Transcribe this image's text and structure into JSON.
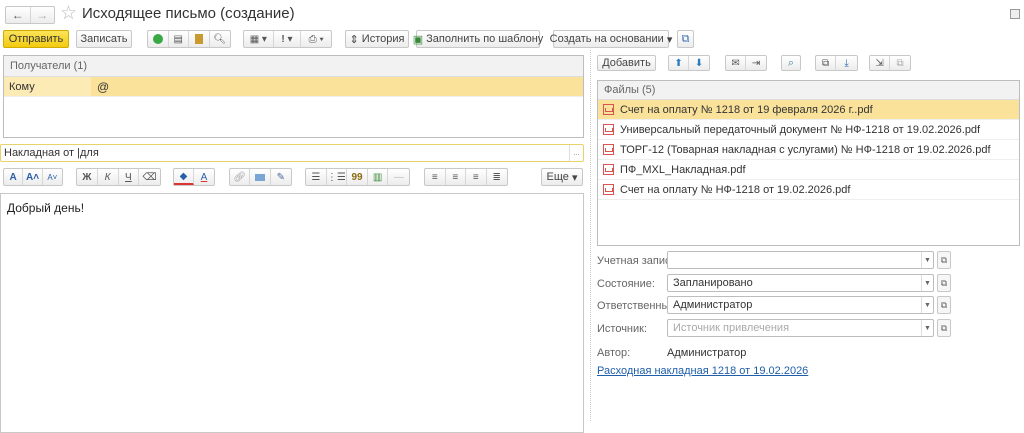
{
  "window": {
    "title": "Исходящее письмо (создание)",
    "back": "←",
    "forward": "→",
    "star": "☆"
  },
  "toolbar": {
    "send": "Отправить",
    "save": "Записать",
    "history": "История",
    "fill_template": "Заполнить по шаблону",
    "create_based": "Создать на основании",
    "importance": "!"
  },
  "recipients": {
    "header": "Получатели (1)",
    "rows": [
      {
        "type": "Кому",
        "address": "@"
      }
    ]
  },
  "subject": {
    "value": "Накладная от |для",
    "more": "..."
  },
  "format": {
    "bold": "Ж",
    "italic": "К",
    "underline": "Ч",
    "more": "Еще"
  },
  "editor": {
    "body": "Добрый день!"
  },
  "files": {
    "add": "Добавить",
    "header": "Файлы (5)",
    "items": [
      "Счет на оплату № 1218 от 19 февраля 2026 г..pdf",
      "Универсальный передаточный документ № НФ-1218 от 19.02.2026.pdf",
      "ТОРГ-12 (Товарная накладная с услугами) № НФ-1218 от 19.02.2026.pdf",
      "ПФ_MXL_Накладная.pdf",
      "Счет на оплату № НФ-1218 от 19.02.2026.pdf"
    ]
  },
  "fields": {
    "account_label": "Учетная запись:",
    "account_value": "",
    "state_label": "Состояние:",
    "state_value": "Запланировано",
    "resp_label": "Ответственный:",
    "resp_value": "Администратор",
    "source_label": "Источник:",
    "source_placeholder": "Источник привлечения",
    "author_label": "Автор:",
    "author_value": "Администратор",
    "link": "Расходная накладная 1218 от 19.02.2026"
  }
}
